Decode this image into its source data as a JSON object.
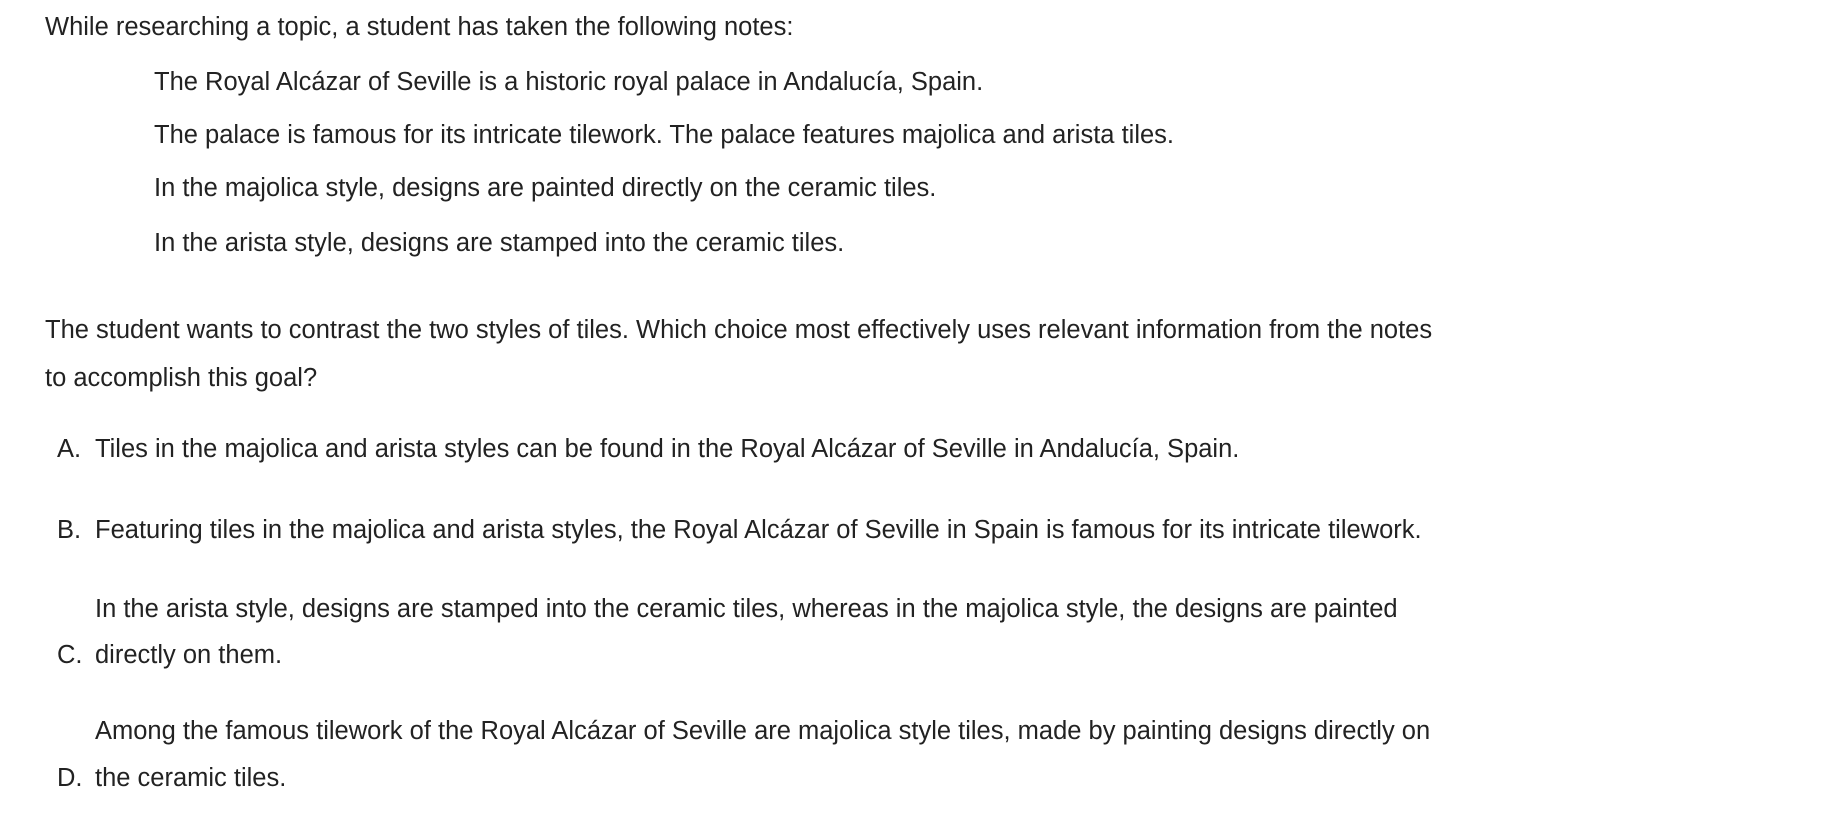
{
  "intro": "While researching a topic, a student has taken the following notes:",
  "notes": [
    "The Royal Alcázar of Seville is a historic royal palace in Andalucía, Spain.",
    "The palace is famous for its intricate tilework. The palace features majolica and arista tiles.",
    "In the majolica style, designs are painted directly on the ceramic tiles.",
    "In the arista style, designs are stamped into the ceramic tiles."
  ],
  "question": {
    "line1": "The student wants to contrast the two styles of tiles. Which choice most effectively uses relevant information from the notes",
    "line2": "to accomplish this goal?"
  },
  "options": [
    {
      "label": "A.",
      "lines": [
        "Tiles in the majolica and arista styles can be found in the Royal Alcázar of Seville in Andalucía, Spain."
      ]
    },
    {
      "label": "B.",
      "lines": [
        "Featuring tiles in the majolica and arista styles, the Royal Alcázar of Seville in Spain is famous for its intricate tilework."
      ]
    },
    {
      "label": "C.",
      "lines": [
        "In the arista style, designs are stamped into the ceramic tiles, whereas in the majolica style, the designs are painted",
        "directly on them."
      ]
    },
    {
      "label": "D.",
      "lines": [
        "Among the famous tilework of the Royal Alcázar of Seville are majolica style tiles, made by painting designs directly on",
        "the ceramic tiles."
      ]
    }
  ]
}
